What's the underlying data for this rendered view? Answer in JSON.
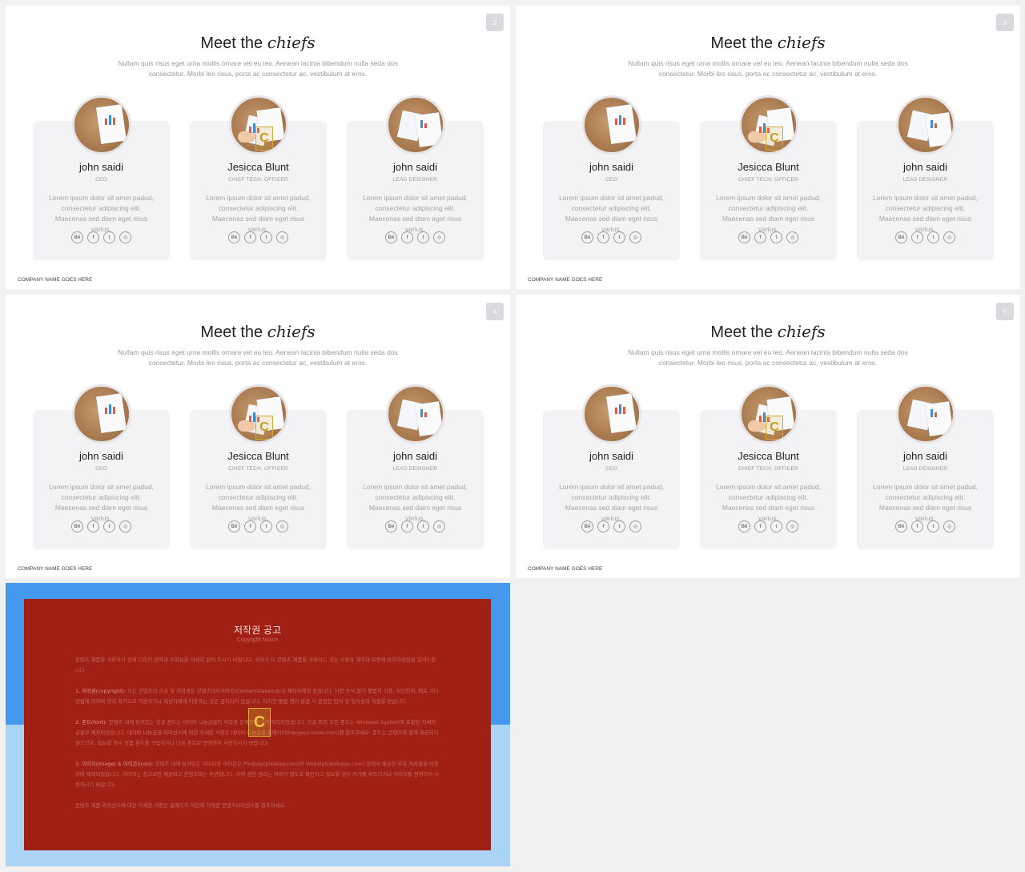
{
  "slides": [
    {
      "number": "2",
      "title_plain": "Meet the",
      "title_italic": "chiefs",
      "subtitle": "Nullam quis risus eget urna mollis ornare vel eu leo. Aenean lacinia bibendum nulla seda dos consectetur. Morbi leo risus, porta ac consectetur ac, vestibulum at eros.",
      "members": [
        {
          "name": "john saidi",
          "role": "CEO",
          "bio": "Lorem ipsum dolor sit amet padud, consectetur adipiscing elit. Maecenas sed diam eget risus varius."
        },
        {
          "name": "Jesicca Blunt",
          "role": "CHIEF TECH, OFFICER",
          "bio": "Lorem ipsum dolor sit amet padud, consectetur adipiscing elit. Maecenas sed diam eget risus varius."
        },
        {
          "name": "john saidi",
          "role": "LEAD DESIGNER",
          "bio": "Lorem ipsum dolor sit amet padud, consectetur adipiscing elit. Maecenas sed diam eget risus varius."
        }
      ],
      "company": "COMPANY NAME GOES HERE"
    },
    {
      "number": "3",
      "title_plain": "Meet the",
      "title_italic": "chiefs",
      "subtitle": "Nullam quis risus eget urna mollis ornare vel eu leo. Aenean lacinia bibendum nulla seda dos consectetur. Morbi leo risus, porta ac consectetur ac, vestibulum at eros.",
      "members": [
        {
          "name": "john saidi",
          "role": "CEO",
          "bio": "Lorem ipsum dolor sit amet padud, consectetur adipiscing elit. Maecenas sed diam eget risus varius."
        },
        {
          "name": "Jesicca Blunt",
          "role": "CHIEF TECH, OFFICER",
          "bio": "Lorem ipsum dolor sit amet padud, consectetur adipiscing elit. Maecenas sed diam eget risus varius."
        },
        {
          "name": "john saidi",
          "role": "LEAD DESIGNER",
          "bio": "Lorem ipsum dolor sit amet padud, consectetur adipiscing elit. Maecenas sed diam eget risus varius."
        }
      ],
      "company": "COMPANY NAME GOES HERE"
    },
    {
      "number": "4",
      "title_plain": "Meet the",
      "title_italic": "chiefs",
      "subtitle": "Nullam quis risus eget urna mollis ornare vel eu leo. Aenean lacinia bibendum nulla seda dos consectetur. Morbi leo risus, porta ac consectetur ac, vestibulum at eros.",
      "members": [
        {
          "name": "john saidi",
          "role": "CEO",
          "bio": "Lorem ipsum dolor sit amet padud, consectetur adipiscing elit. Maecenas sed diam eget risus varius."
        },
        {
          "name": "Jesicca Blunt",
          "role": "CHIEF TECH, OFFICER",
          "bio": "Lorem ipsum dolor sit amet padud, consectetur adipiscing elit. Maecenas sed diam eget risus varius."
        },
        {
          "name": "john saidi",
          "role": "LEAD DESIGNER",
          "bio": "Lorem ipsum dolor sit amet padud, consectetur adipiscing elit. Maecenas sed diam eget risus varius."
        }
      ],
      "company": "COMPANY NAME GOES HERE"
    },
    {
      "number": "5",
      "title_plain": "Meet the",
      "title_italic": "chiefs",
      "subtitle": "Nullam quis risus eget urna mollis ornare vel eu leo. Aenean lacinia bibendum nulla seda dos consectetur. Morbi leo risus, porta ac consectetur ac, vestibulum at eros.",
      "members": [
        {
          "name": "john saidi",
          "role": "CEO",
          "bio": "Lorem ipsum dolor sit amet padud, consectetur adipiscing elit. Maecenas sed diam eget risus varius."
        },
        {
          "name": "Jesicca Blunt",
          "role": "CHIEF TECH, OFFICER",
          "bio": "Lorem ipsum dolor sit amet padud, consectetur adipiscing elit. Maecenas sed diam eget risus varius."
        },
        {
          "name": "john saidi",
          "role": "LEAD DESIGNER",
          "bio": "Lorem ipsum dolor sit amet padud, consectetur adipiscing elit. Maecenas sed diam eget risus varius."
        }
      ],
      "company": "COMPANY NAME GOES HERE"
    }
  ],
  "social_icons": [
    {
      "icon": "behance-icon",
      "glyph": "Bē"
    },
    {
      "icon": "facebook-icon",
      "glyph": "f"
    },
    {
      "icon": "twitter-icon",
      "glyph": "t"
    },
    {
      "icon": "instagram-icon",
      "glyph": "◎"
    }
  ],
  "notice": {
    "title": "저작권 공고",
    "subtitle": "Copyright Notice",
    "intro": "콘텐츠 제품을 사용하기 전에 다음의 협약과 조항들을 자세히 읽어 주시기 바랍니다. 귀하가 이 콘텐츠 제품을 사용하는 것은 사용자 계약과 보증에 동의하셨음을 알려드립니다.",
    "section1_head": "1. 저작권(copyright):",
    "section1": " 모든 콘텐츠의 소유 및 저작권은 콘텐츠테이크아웃(Contentstakeout)과 제작자에게 있습니다. 사전 승낙 없이 불법적 이용, 무단전재, 배포 기타 방법에 의하여 영리 목적으로 이용하거나 제삼자에게 이용하는 것은 금지되어 있습니다. 이러한 불법 행위 발견 시 준엄한 민사 및 형사상의 처벌을 받습니다.",
    "section2_head": "2. 폰트(font):",
    "section2": " 콘텐츠 내에 담겨있는 한글 폰트는 네이버 나눔글꼴의 저작권 문제를 피하여 제작되었습니다. 한글 외의 모든 폰트는 Windows System에 포함된 자체의 글꼴로 제작되었습니다. 네이버 나눔글꼴 라이선스에 대한 자세한 사항은 네이버 나눔글꼴 홈페이지(hangeul.naver.com)를 참조하세요. 폰트는 콘텐츠와 함께 제공되지 않으므로, 필요할 경우 정품 폰트를 구입하거나 다른 폰트로 변경하여 사용하시기 바랍니다.",
    "section3_head": "3. 이미지(image) & 아이콘(icon):",
    "section3": " 콘텐츠 내에 담겨있는 이미지와 아이콘은 Pixabay(pixabay.com)와 Webalys(webalys.com) 등에서 제공한 무료 저작물을 이용하여 제작되었습니다. 이미지는 참고로만 제공되고 콘텐츠와는 무관합니다. 이에 관한 권리는 귀하가 별도로 확인하고 필요할 경우 허가를 취득하거나 이미지를 변경하여 사용하시기 바랍니다.",
    "closing": "콘텐츠 제품 라이선스에 대한 자세한 사항은 홈페이지 하단에 기재한 콘텐츠라이선스를 참조하세요.",
    "logo_glyph": "C"
  },
  "colors": {
    "notice_red": "#a02015",
    "notice_blue_top": "#4499ee",
    "notice_blue_bottom": "#a9d4f5"
  }
}
